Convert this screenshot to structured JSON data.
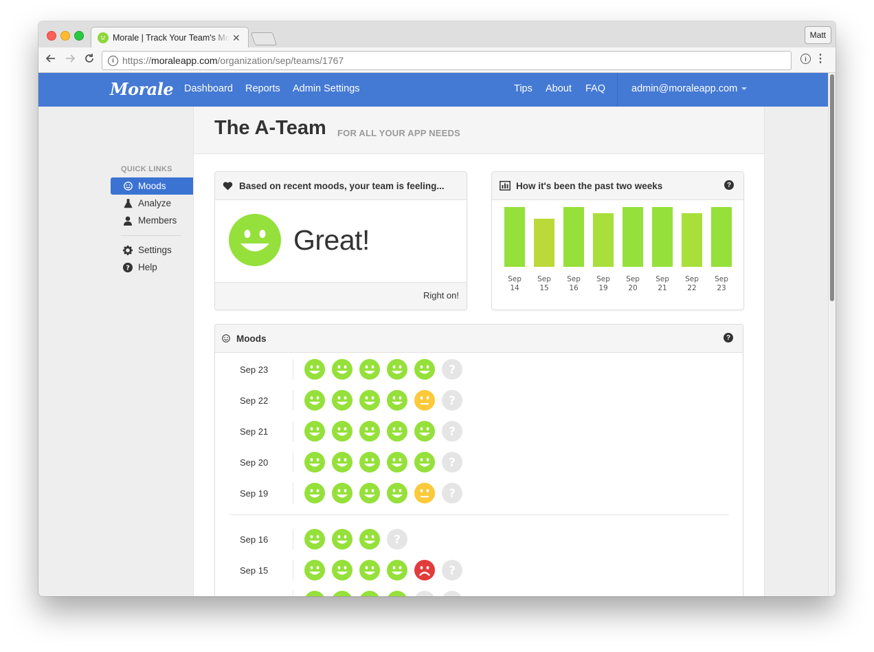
{
  "browser": {
    "tab_title": "Morale | Track Your Team's Mood",
    "profile": "Matt",
    "url_scheme": "https://",
    "url_domain": "moraleapp.com",
    "url_path": "/organization/sep/teams/1767"
  },
  "navbar": {
    "brand": "Morale",
    "left_links": [
      "Dashboard",
      "Reports",
      "Admin Settings"
    ],
    "right_links": [
      "Tips",
      "About",
      "FAQ"
    ],
    "user": "admin@moraleapp.com"
  },
  "sidebar": {
    "title": "QUICK LINKS",
    "items": [
      {
        "label": "Moods",
        "icon": "smile-icon",
        "active": true
      },
      {
        "label": "Analyze",
        "icon": "flask-icon",
        "active": false
      },
      {
        "label": "Members",
        "icon": "user-icon",
        "active": false
      },
      {
        "label": "Settings",
        "icon": "gear-icon",
        "active": false
      },
      {
        "label": "Help",
        "icon": "question-circle-icon",
        "active": false
      }
    ]
  },
  "header": {
    "team_name": "The A-Team",
    "subtitle": "FOR ALL YOUR APP NEEDS"
  },
  "feeling_panel": {
    "title": "Based on recent moods, your team is feeling...",
    "mood_word": "Great!",
    "footer": "Right on!"
  },
  "chart_data": {
    "type": "bar",
    "title": "How it's been the past two weeks",
    "categories": [
      [
        "Sep",
        "14"
      ],
      [
        "Sep",
        "15"
      ],
      [
        "Sep",
        "16"
      ],
      [
        "Sep",
        "19"
      ],
      [
        "Sep",
        "20"
      ],
      [
        "Sep",
        "21"
      ],
      [
        "Sep",
        "22"
      ],
      [
        "Sep",
        "23"
      ]
    ],
    "values": [
      1.0,
      0.8,
      1.0,
      0.9,
      1.0,
      1.0,
      0.9,
      1.0
    ],
    "colors": [
      "#95e03a",
      "#bcd93a",
      "#95e03a",
      "#a8df3a",
      "#95e03a",
      "#95e03a",
      "#a8df3a",
      "#95e03a"
    ],
    "ylim": [
      0,
      1
    ],
    "grid": false
  },
  "moods_panel": {
    "title": "Moods",
    "groups": [
      [
        {
          "date": "Sep 23",
          "moods": [
            "happy",
            "happy",
            "happy",
            "happy",
            "happy",
            "unknown"
          ]
        },
        {
          "date": "Sep 22",
          "moods": [
            "happy",
            "happy",
            "happy",
            "happy",
            "neutral",
            "unknown"
          ]
        },
        {
          "date": "Sep 21",
          "moods": [
            "happy",
            "happy",
            "happy",
            "happy",
            "happy",
            "unknown"
          ]
        },
        {
          "date": "Sep 20",
          "moods": [
            "happy",
            "happy",
            "happy",
            "happy",
            "happy",
            "unknown"
          ]
        },
        {
          "date": "Sep 19",
          "moods": [
            "happy",
            "happy",
            "happy",
            "happy",
            "neutral",
            "unknown"
          ]
        }
      ],
      [
        {
          "date": "Sep 16",
          "moods": [
            "happy",
            "happy",
            "happy",
            "unknown"
          ]
        },
        {
          "date": "Sep 15",
          "moods": [
            "happy",
            "happy",
            "happy",
            "happy",
            "sad",
            "unknown"
          ]
        },
        {
          "date": "",
          "moods": [
            "happy",
            "happy",
            "happy",
            "happy",
            "unknown",
            "unknown"
          ]
        }
      ]
    ]
  },
  "colors": {
    "navbar": "#4479d4",
    "happy": "#95e03a",
    "neutral": "#fbc93a",
    "sad": "#e23b3b",
    "unknown": "#e5e5e5"
  }
}
